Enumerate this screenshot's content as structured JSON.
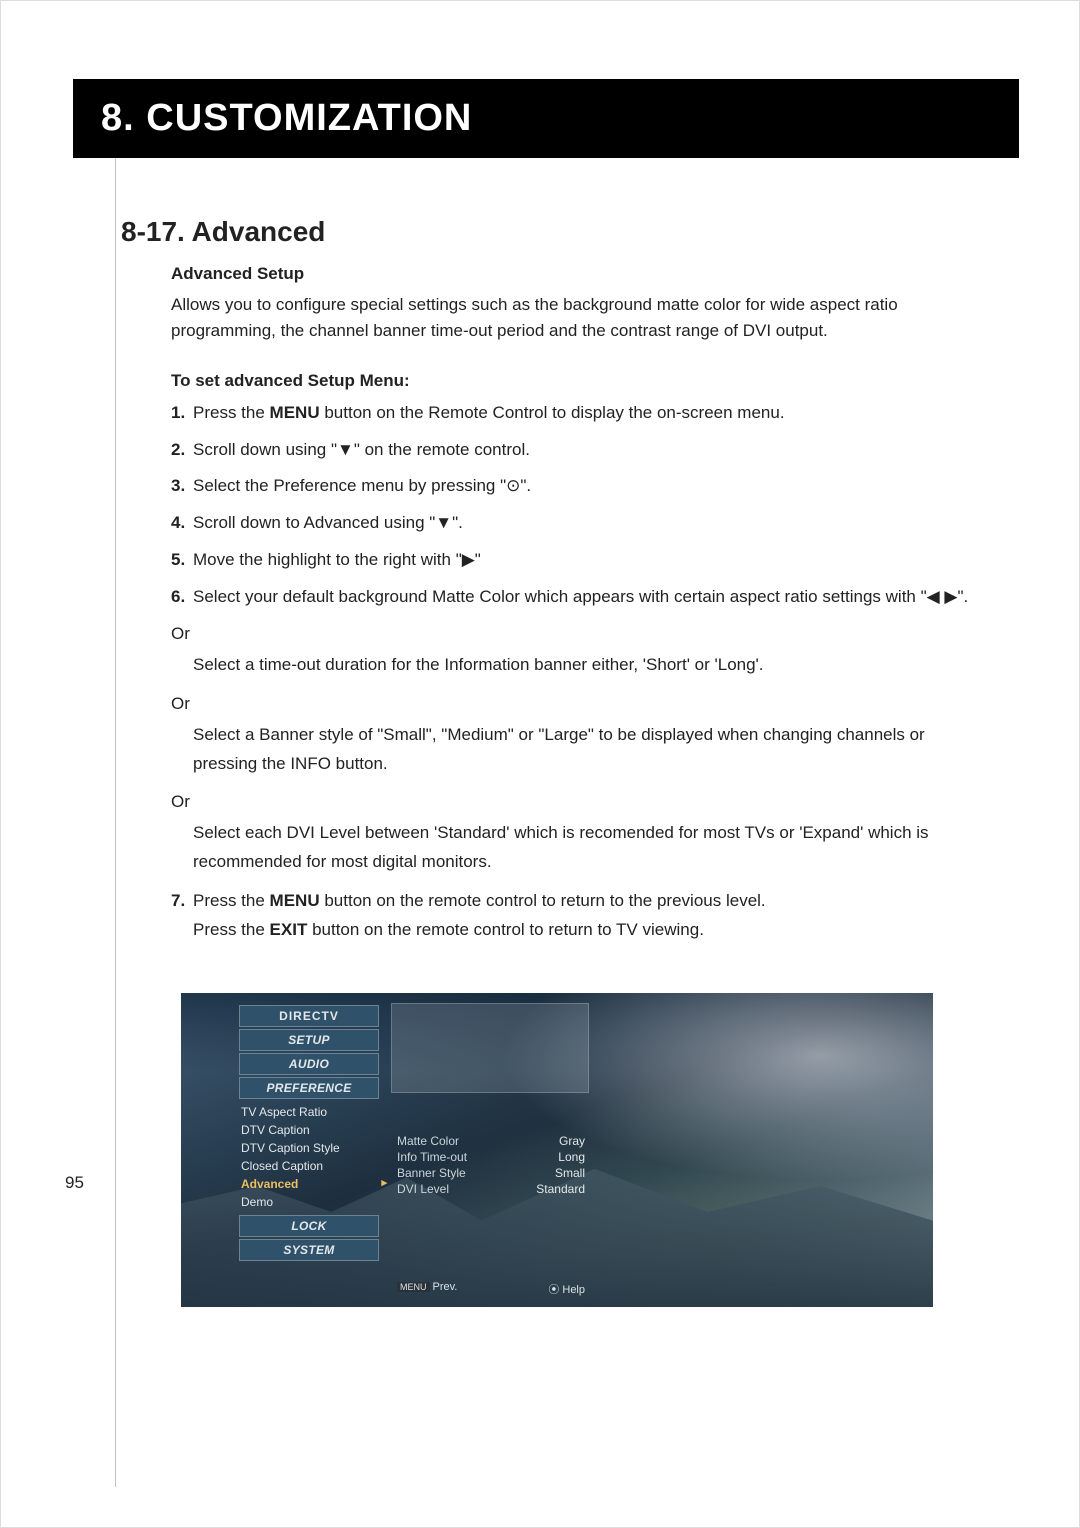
{
  "chapter": "8. CUSTOMIZATION",
  "section_title": "8-17. Advanced",
  "page_number": "95",
  "sub1": "Advanced Setup",
  "sub1_body": "Allows you to configure special settings such as the background matte color for wide aspect ratio programming, the channel banner time-out period and the contrast range of DVI output.",
  "sub2": "To set advanced Setup Menu:",
  "steps": {
    "s1_num": "1.",
    "s1_a": "Press the ",
    "s1_b": "MENU",
    "s1_c": " button on the Remote Control to display the on-screen menu.",
    "s2_num": "2.",
    "s2": "Scroll down using \"▼\" on the remote control.",
    "s3_num": "3.",
    "s3": "Select the Preference menu by pressing \"⊙\".",
    "s4_num": "4.",
    "s4": "Scroll down to Advanced using \"▼\".",
    "s5_num": "5.",
    "s5": "Move the highlight to the right with \"▶\"",
    "s6_num": "6.",
    "s6": "Select your default background Matte Color which appears with certain aspect ratio settings with \"◀ ▶\".",
    "or": "Or",
    "or1": "Select a time-out duration for the Information banner either, 'Short' or 'Long'.",
    "or2": "Select a Banner style of \"Small\", \"Medium\" or \"Large\" to be displayed when changing channels or pressing the INFO button.",
    "or3": "Select each DVI Level between 'Standard' which is recomended for most TVs or 'Expand' which is recommended for most digital monitors.",
    "s7_num": "7.",
    "s7_a": "Press the ",
    "s7_b": "MENU",
    "s7_c": " button on the remote control to return to the previous level.",
    "s7_d": "Press the ",
    "s7_e": "EXIT",
    "s7_f": " button on the remote control to return to TV viewing."
  },
  "tv": {
    "brand": "DIRECTV",
    "menu": [
      "SETUP",
      "AUDIO",
      "PREFERENCE"
    ],
    "pref_items": [
      "TV Aspect Ratio",
      "DTV Caption",
      "DTV Caption Style",
      "Closed Caption",
      "Advanced",
      "Demo"
    ],
    "menu_bottom": [
      "LOCK",
      "SYSTEM"
    ],
    "options": [
      {
        "label": "Matte Color",
        "value": "Gray"
      },
      {
        "label": "Info Time-out",
        "value": "Long"
      },
      {
        "label": "Banner Style",
        "value": "Small"
      },
      {
        "label": "DVI Level",
        "value": "Standard"
      }
    ],
    "footer_prev_tag": "MENU",
    "footer_prev": "Prev.",
    "footer_help_icon": "⦿",
    "footer_help": "Help"
  }
}
